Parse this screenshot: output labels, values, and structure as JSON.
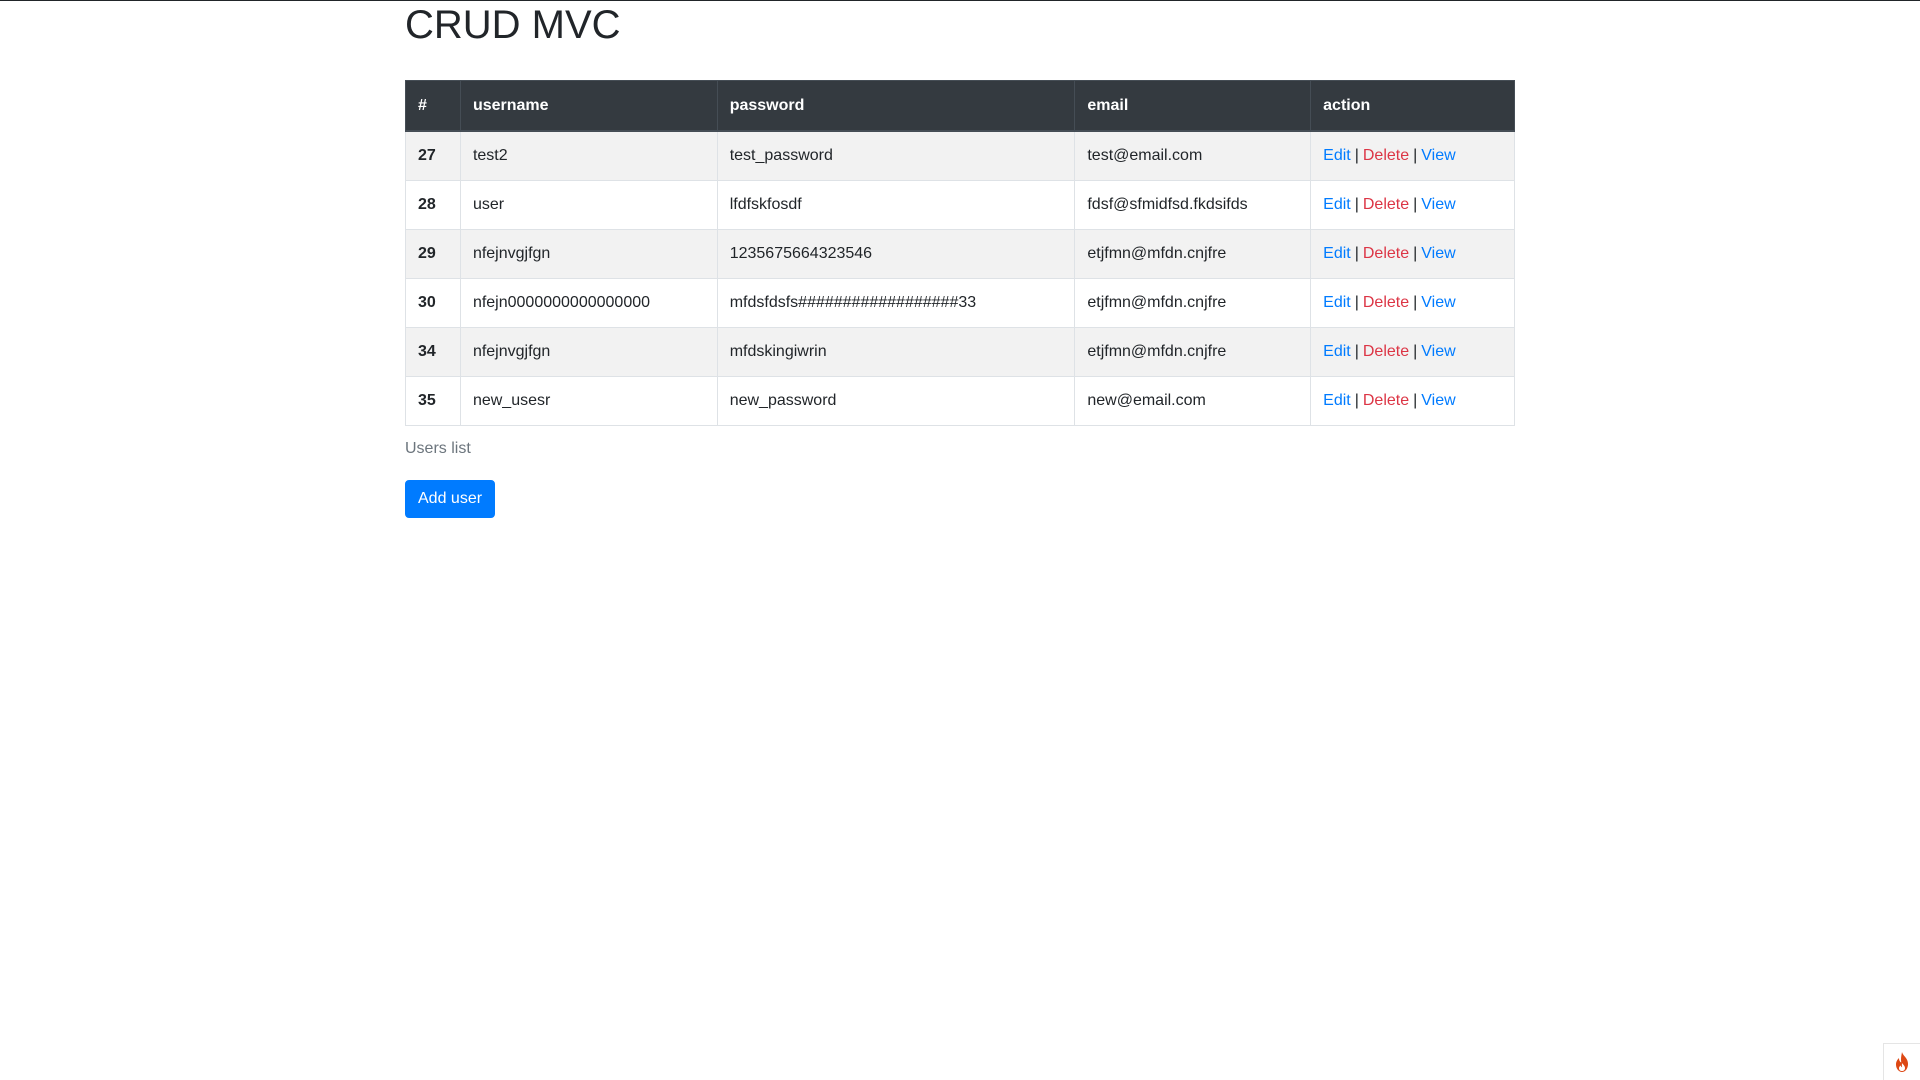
{
  "page": {
    "title": "CRUD MVC"
  },
  "table": {
    "headers": [
      "#",
      "username",
      "password",
      "email",
      "action"
    ],
    "rows": [
      {
        "id": "27",
        "username": "test2",
        "password": "test_password",
        "email": "test@email.com"
      },
      {
        "id": "28",
        "username": "user",
        "password": "lfdfskfosdf",
        "email": "fdsf@sfmidfsd.fkdsifds"
      },
      {
        "id": "29",
        "username": "nfejnvgjfgn",
        "password": "1235675664323546",
        "email": "etjfmn@mfdn.cnjfre"
      },
      {
        "id": "30",
        "username": "nfejn0000000000000000",
        "password": "mfdsfdsfs##################33",
        "email": "etjfmn@mfdn.cnjfre"
      },
      {
        "id": "34",
        "username": "nfejnvgjfgn",
        "password": "mfdskingiwrin",
        "email": "etjfmn@mfdn.cnjfre"
      },
      {
        "id": "35",
        "username": "new_usesr",
        "password": "new_password",
        "email": "new@email.com"
      }
    ],
    "actions": {
      "edit": "Edit",
      "delete": "Delete",
      "view": "View",
      "separator": "|"
    },
    "caption": "Users list"
  },
  "add_button": {
    "label": "Add user"
  },
  "colors": {
    "header_bg": "#343a40",
    "link_primary": "#007bff",
    "link_danger": "#dc3545",
    "button_bg": "#007bff",
    "debug_icon": "#dd4814"
  },
  "icons": {
    "debug_toolbar": "flame-icon"
  }
}
